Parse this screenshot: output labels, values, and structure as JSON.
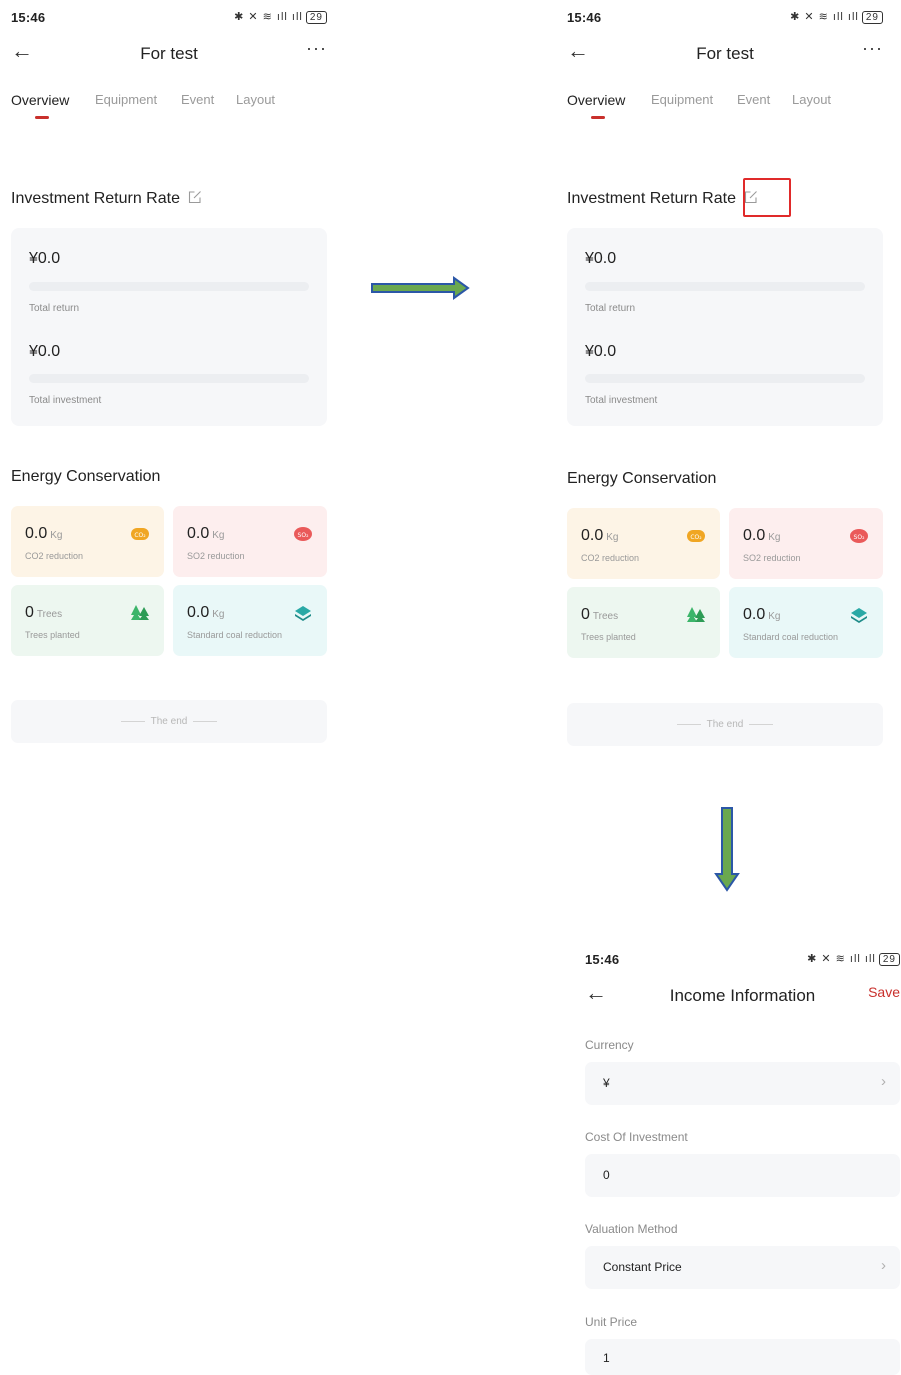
{
  "status": {
    "time": "15:46",
    "icons": "✱ ✕ ≋ ıll ıll",
    "battery": "29"
  },
  "screen1": {
    "title": "For test",
    "tabs": [
      "Overview",
      "Equipment",
      "Event",
      "Layout"
    ],
    "investment": {
      "title": "Investment Return Rate",
      "total_return_value": "¥0.0",
      "total_return_label": "Total return",
      "total_investment_value": "¥0.0",
      "total_investment_label": "Total investment"
    },
    "energy": {
      "title": "Energy Conservation",
      "tiles": [
        {
          "value": "0.0",
          "unit": "Kg",
          "label": "CO2 reduction",
          "icon": "co2-icon",
          "bg": "#fdf4e6",
          "color": "#f0a623"
        },
        {
          "value": "0.0",
          "unit": "Kg",
          "label": "SO2 reduction",
          "icon": "so2-icon",
          "bg": "#fdeeee",
          "color": "#ea5a5a"
        },
        {
          "value": "0",
          "unit": "Trees",
          "label": "Trees planted",
          "icon": "trees-icon",
          "bg": "#edf7f0",
          "color": "#3cb56a"
        },
        {
          "value": "0.0",
          "unit": "Kg",
          "label": "Standard coal reduction",
          "icon": "coal-icon",
          "bg": "#e9f8f8",
          "color": "#2aa9a6"
        }
      ]
    },
    "end_text": "The end"
  },
  "screen3": {
    "title": "Income Information",
    "save_label": "Save",
    "fields": [
      {
        "label": "Currency",
        "value": "¥"
      },
      {
        "label": "Cost Of Investment",
        "value": "0"
      },
      {
        "label": "Valuation Method",
        "value": "Constant Price"
      },
      {
        "label": "Unit Price",
        "value": "1"
      }
    ]
  },
  "colors": {
    "accent": "#c9302c",
    "arrow_fill": "#6aa84f",
    "arrow_stroke": "#2b57a7",
    "highlight": "#e02a2a"
  }
}
